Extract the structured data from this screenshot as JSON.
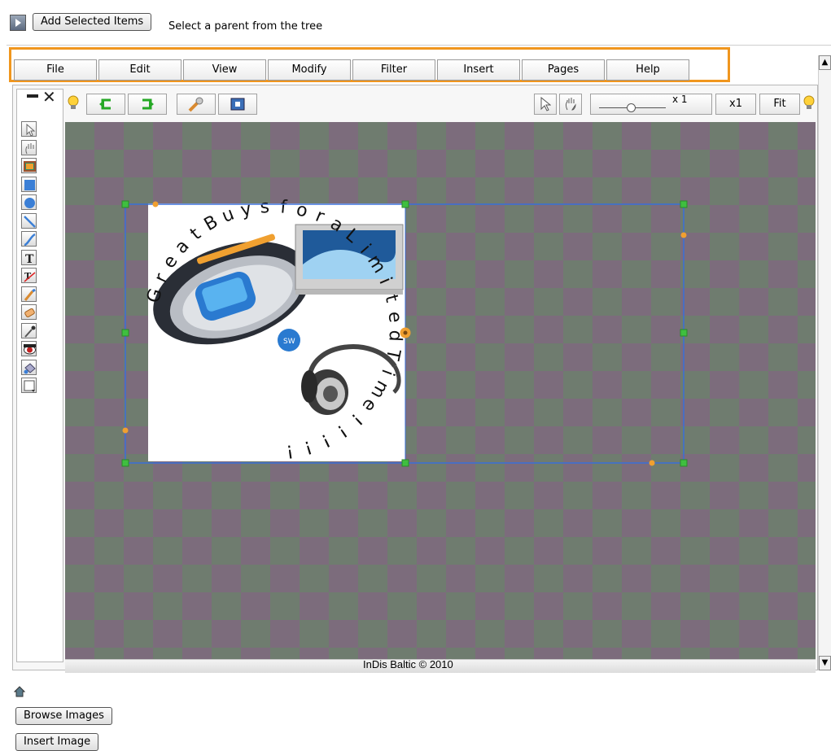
{
  "top": {
    "add_button_label": "Add Selected Items",
    "hint": "Select a parent from the tree"
  },
  "menu": [
    "File",
    "Edit",
    "View",
    "Modify",
    "Filter",
    "Insert",
    "Pages",
    "Help"
  ],
  "toolbar": {
    "zoom_label": "x 1",
    "x1_label": "x1",
    "fit_label": "Fit",
    "zoom_slider_fraction": 0.1
  },
  "tools": [
    "select-arrow-icon",
    "hand-pan-icon",
    "image-icon",
    "rectangle-icon",
    "circle-icon",
    "line-icon",
    "curve-icon",
    "text-icon",
    "text-path-icon",
    "brush-icon",
    "eraser-icon",
    "eyedropper-icon",
    "redeye-icon",
    "paint-bucket-icon",
    "color-swatch-icon"
  ],
  "canvas": {
    "curved_text": "Great Buys for a Limited Time!!!!!",
    "letters": [
      "G",
      "r",
      "e",
      "a",
      "t",
      "B",
      "u",
      "y",
      "s",
      "f",
      "o",
      "r",
      "a",
      "L",
      "i",
      "m",
      "i",
      "t",
      "e",
      "d",
      "T",
      "i",
      "m",
      "e",
      "!",
      "!",
      "!",
      "!",
      "!"
    ],
    "colors": {
      "checker_a": "#6e7c6e",
      "checker_b": "#7a6a7a",
      "selection": "#3a6fd8",
      "handle": "#3fbf3f",
      "rotate_handle": "#f0a030"
    }
  },
  "footer": {
    "copyright": "InDis Baltic © 2010"
  },
  "bottom": {
    "browse_label": "Browse Images",
    "insert_label": "Insert Image"
  }
}
